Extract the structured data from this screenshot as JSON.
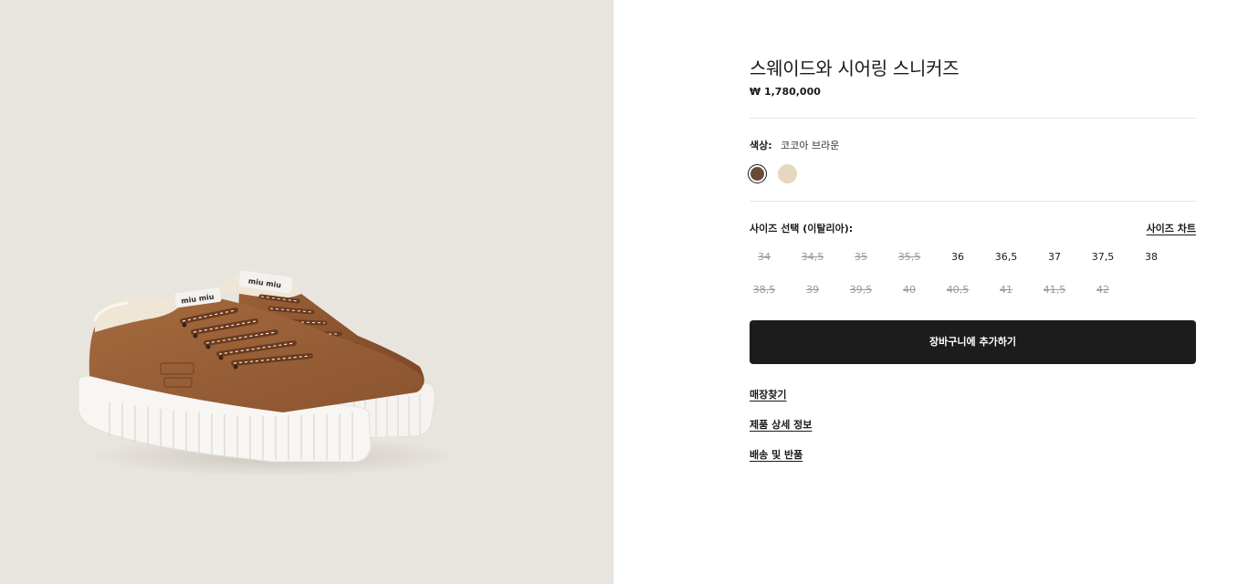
{
  "product": {
    "title": "스웨이드와 시어링 스니커즈",
    "price": "₩ 1,780,000",
    "image_alt": "스웨이드와 시어링 스니커즈",
    "brand_mark": "miu miu"
  },
  "color": {
    "label": "색상:",
    "selected_name": "코코아 브라운",
    "swatches": [
      {
        "name": "코코아 브라운",
        "hex": "#6b4a3a",
        "selected": true
      },
      {
        "name": "crema",
        "hex": "#e6d8c0",
        "selected": false
      }
    ]
  },
  "size": {
    "label": "사이즈 선택 (이탈리아):",
    "chart_link": "사이즈 차트",
    "options": [
      {
        "label": "34",
        "available": false
      },
      {
        "label": "34,5",
        "available": false
      },
      {
        "label": "35",
        "available": false
      },
      {
        "label": "35,5",
        "available": false
      },
      {
        "label": "36",
        "available": true
      },
      {
        "label": "36,5",
        "available": true
      },
      {
        "label": "37",
        "available": true
      },
      {
        "label": "37,5",
        "available": true
      },
      {
        "label": "38",
        "available": true
      },
      {
        "label": "38,5",
        "available": false
      },
      {
        "label": "39",
        "available": false
      },
      {
        "label": "39,5",
        "available": false
      },
      {
        "label": "40",
        "available": false
      },
      {
        "label": "40,5",
        "available": false
      },
      {
        "label": "41",
        "available": false
      },
      {
        "label": "41,5",
        "available": false
      },
      {
        "label": "42",
        "available": false
      }
    ]
  },
  "actions": {
    "add_to_cart": "장바구니에 추가하기"
  },
  "links": {
    "store_finder": "매장찾기",
    "product_details": "제품 상세 정보",
    "shipping_returns": "배송 및 반품"
  },
  "colors": {
    "gallery_bg": "#e8e4de",
    "button_bg": "#1c1c1c",
    "suede": "#8a5430",
    "sole": "#f6f5f2"
  }
}
